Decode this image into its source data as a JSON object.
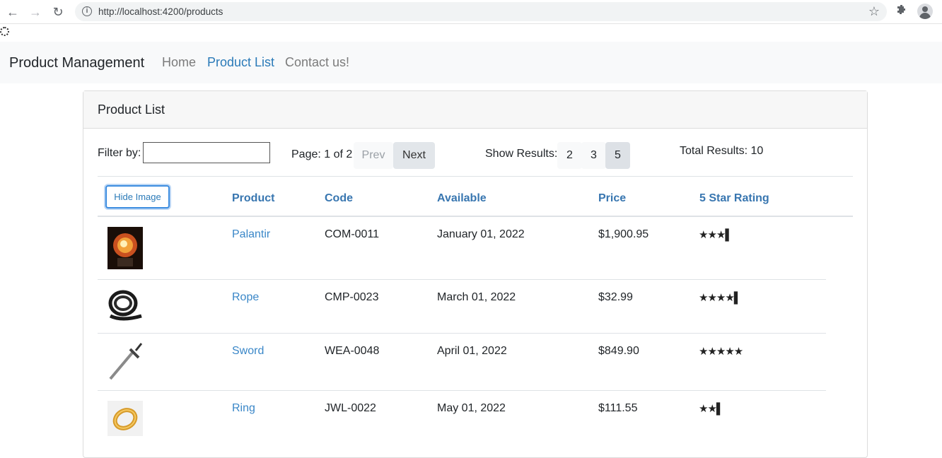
{
  "browser": {
    "url": "http://localhost:4200/products",
    "back_icon": "←",
    "forward_icon": "→",
    "reload_icon": "↻",
    "bookmark_icon": "☆",
    "extensions_icon": "⚙"
  },
  "navbar": {
    "brand": "Product Management",
    "links": [
      {
        "label": "Home"
      },
      {
        "label": "Product List"
      },
      {
        "label": "Contact us!"
      }
    ]
  },
  "card": {
    "title": "Product List",
    "filter_label": "Filter by:",
    "filter_value": "",
    "page_label": "Page: 1 of 2",
    "prev_label": "Prev",
    "next_label": "Next",
    "show_results_label": "Show Results:",
    "page_sizes": [
      "2",
      "3",
      "5"
    ],
    "selected_page_size": "5",
    "total_results": "Total Results: 10"
  },
  "table": {
    "hide_image_label": "Hide Image",
    "headers": [
      "Product",
      "Code",
      "Available",
      "Price",
      "5 Star Rating"
    ],
    "rows": [
      {
        "name": "Palantir",
        "code": "COM-0011",
        "available": "January 01, 2022",
        "price": "$1,900.95",
        "rating": 3.5,
        "stars": "★★★▌"
      },
      {
        "name": "Rope",
        "code": "CMP-0023",
        "available": "March 01, 2022",
        "price": "$32.99",
        "rating": 4.5,
        "stars": "★★★★▌"
      },
      {
        "name": "Sword",
        "code": "WEA-0048",
        "available": "April 01, 2022",
        "price": "$849.90",
        "rating": 5,
        "stars": "★★★★★"
      },
      {
        "name": "Ring",
        "code": "JWL-0022",
        "available": "May 01, 2022",
        "price": "$111.55",
        "rating": 2.5,
        "stars": "★★▌"
      }
    ]
  }
}
